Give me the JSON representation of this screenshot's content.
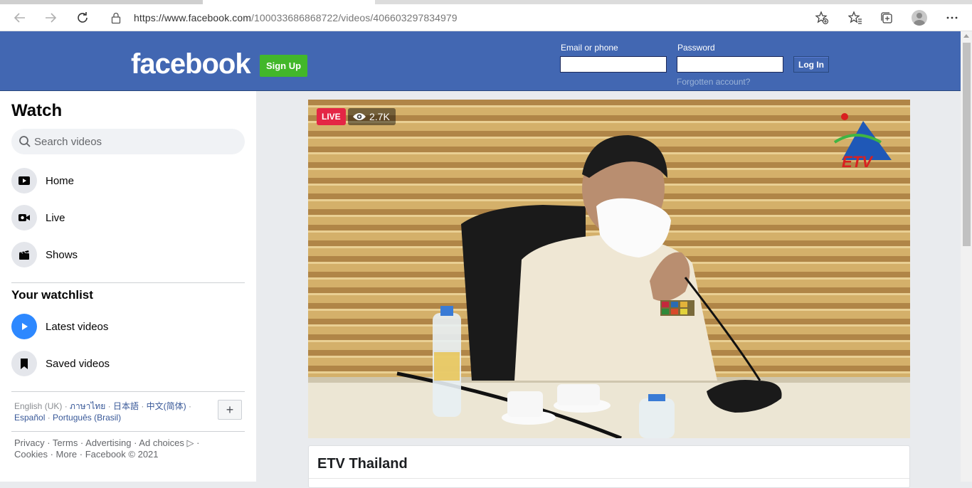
{
  "browser": {
    "url_host": "https://www.facebook.com",
    "url_path": "/100033686868722/videos/406603297834979"
  },
  "header": {
    "logo": "facebook",
    "signup_label": "Sign Up",
    "email_label": "Email or phone",
    "password_label": "Password",
    "login_label": "Log In",
    "forgot_label": "Forgotten account?"
  },
  "sidebar": {
    "title": "Watch",
    "search_placeholder": "Search videos",
    "items": [
      {
        "label": "Home",
        "icon": "video-play-icon"
      },
      {
        "label": "Live",
        "icon": "live-camera-icon"
      },
      {
        "label": "Shows",
        "icon": "clapperboard-icon"
      }
    ],
    "watchlist_title": "Your watchlist",
    "watchlist": [
      {
        "label": "Latest videos",
        "icon": "play-circle-icon"
      },
      {
        "label": "Saved videos",
        "icon": "bookmark-icon"
      }
    ],
    "languages": {
      "current": "English (UK)",
      "others": [
        "ภาษาไทย",
        "日本語",
        "中文(简体)",
        "Español",
        "Português (Brasil)"
      ]
    },
    "footer": "Privacy · Terms · Advertising · Ad choices ▷ · Cookies · More · Facebook © 2021"
  },
  "video": {
    "live_label": "LIVE",
    "views": "2.7K",
    "channel_logo": "ETV"
  },
  "post": {
    "title": "ETV Thailand"
  },
  "colors": {
    "fb_blue": "#4267b2",
    "signup_green": "#42b72a",
    "live_red": "#e42645"
  }
}
